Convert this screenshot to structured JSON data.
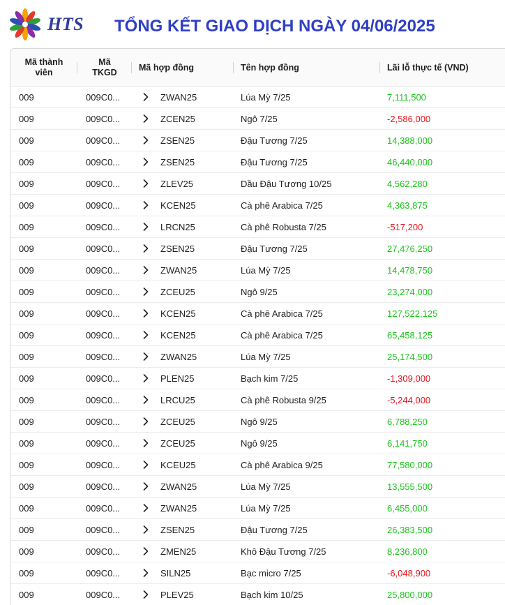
{
  "header": {
    "logo_text": "HTS",
    "title": "TỔNG KẾT GIAO DỊCH NGÀY 04/06/2025"
  },
  "colors": {
    "positive": "#1ac41a",
    "negative": "#e8141b",
    "title": "#2f3fc4"
  },
  "table": {
    "columns": [
      {
        "label": "Mã thành\nviên"
      },
      {
        "label": "Mã\nTKGD"
      },
      {
        "label": "Mã hợp đồng"
      },
      {
        "label": "Tên hợp đồng"
      },
      {
        "label": "Lãi lỗ thực tế (VND)"
      }
    ],
    "rows": [
      {
        "member": "009",
        "tkgd": "009C0...",
        "code": "ZWAN25",
        "name": "Lúa Mỳ 7/25",
        "pnl": "7,111,500",
        "sign": "pos"
      },
      {
        "member": "009",
        "tkgd": "009C0...",
        "code": "ZCEN25",
        "name": "Ngô 7/25",
        "pnl": "-2,586,000",
        "sign": "neg"
      },
      {
        "member": "009",
        "tkgd": "009C0...",
        "code": "ZSEN25",
        "name": "Đậu Tương 7/25",
        "pnl": "14,388,000",
        "sign": "pos"
      },
      {
        "member": "009",
        "tkgd": "009C0...",
        "code": "ZSEN25",
        "name": "Đậu Tương 7/25",
        "pnl": "46,440,000",
        "sign": "pos"
      },
      {
        "member": "009",
        "tkgd": "009C0...",
        "code": "ZLEV25",
        "name": "Dầu Đậu Tương 10/25",
        "pnl": "4,562,280",
        "sign": "pos"
      },
      {
        "member": "009",
        "tkgd": "009C0...",
        "code": "KCEN25",
        "name": "Cà phê Arabica 7/25",
        "pnl": "4,363,875",
        "sign": "pos"
      },
      {
        "member": "009",
        "tkgd": "009C0...",
        "code": "LRCN25",
        "name": "Cà phê Robusta 7/25",
        "pnl": "-517,200",
        "sign": "neg"
      },
      {
        "member": "009",
        "tkgd": "009C0...",
        "code": "ZSEN25",
        "name": "Đậu Tương 7/25",
        "pnl": "27,476,250",
        "sign": "pos"
      },
      {
        "member": "009",
        "tkgd": "009C0...",
        "code": "ZWAN25",
        "name": "Lúa Mỳ 7/25",
        "pnl": "14,478,750",
        "sign": "pos"
      },
      {
        "member": "009",
        "tkgd": "009C0...",
        "code": "ZCEU25",
        "name": "Ngô 9/25",
        "pnl": "23,274,000",
        "sign": "pos"
      },
      {
        "member": "009",
        "tkgd": "009C0...",
        "code": "KCEN25",
        "name": "Cà phê Arabica 7/25",
        "pnl": "127,522,125",
        "sign": "pos"
      },
      {
        "member": "009",
        "tkgd": "009C0...",
        "code": "KCEN25",
        "name": "Cà phê Arabica 7/25",
        "pnl": "65,458,125",
        "sign": "pos"
      },
      {
        "member": "009",
        "tkgd": "009C0...",
        "code": "ZWAN25",
        "name": "Lúa Mỳ 7/25",
        "pnl": "25,174,500",
        "sign": "pos"
      },
      {
        "member": "009",
        "tkgd": "009C0...",
        "code": "PLEN25",
        "name": "Bạch kim 7/25",
        "pnl": "-1,309,000",
        "sign": "neg"
      },
      {
        "member": "009",
        "tkgd": "009C0...",
        "code": "LRCU25",
        "name": "Cà phê Robusta 9/25",
        "pnl": "-5,244,000",
        "sign": "neg"
      },
      {
        "member": "009",
        "tkgd": "009C0...",
        "code": "ZCEU25",
        "name": "Ngô 9/25",
        "pnl": "6,788,250",
        "sign": "pos"
      },
      {
        "member": "009",
        "tkgd": "009C0...",
        "code": "ZCEU25",
        "name": "Ngô 9/25",
        "pnl": "6,141,750",
        "sign": "pos"
      },
      {
        "member": "009",
        "tkgd": "009C0...",
        "code": "KCEU25",
        "name": "Cà phê Arabica 9/25",
        "pnl": "77,580,000",
        "sign": "pos"
      },
      {
        "member": "009",
        "tkgd": "009C0...",
        "code": "ZWAN25",
        "name": "Lúa Mỳ 7/25",
        "pnl": "13,555,500",
        "sign": "pos"
      },
      {
        "member": "009",
        "tkgd": "009C0...",
        "code": "ZWAN25",
        "name": "Lúa Mỳ 7/25",
        "pnl": "6,455,000",
        "sign": "pos"
      },
      {
        "member": "009",
        "tkgd": "009C0...",
        "code": "ZSEN25",
        "name": "Đậu Tương 7/25",
        "pnl": "26,383,500",
        "sign": "pos"
      },
      {
        "member": "009",
        "tkgd": "009C0...",
        "code": "ZMEN25",
        "name": "Khô Đậu Tương 7/25",
        "pnl": "8,236,800",
        "sign": "pos"
      },
      {
        "member": "009",
        "tkgd": "009C0...",
        "code": "SILN25",
        "name": "Bạc micro 7/25",
        "pnl": "-6,048,900",
        "sign": "neg"
      },
      {
        "member": "009",
        "tkgd": "009C0...",
        "code": "PLEV25",
        "name": "Bạch kim 10/25",
        "pnl": "25,800,000",
        "sign": "pos"
      }
    ]
  }
}
